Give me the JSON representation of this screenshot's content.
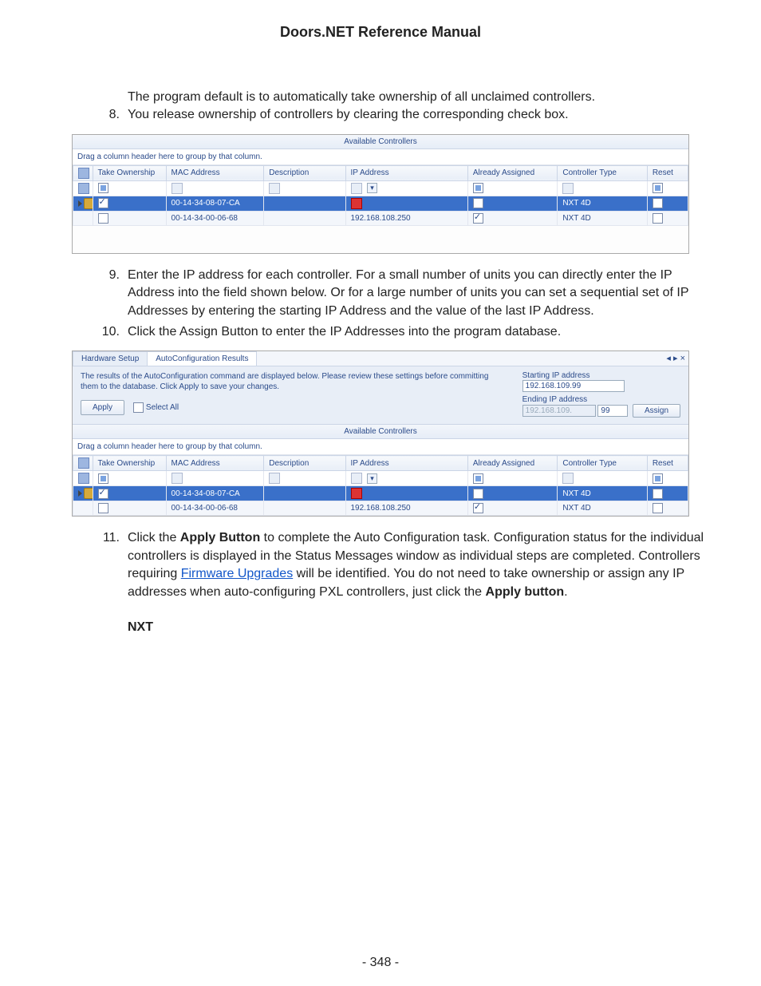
{
  "doc": {
    "title": "Doors.NET Reference Manual",
    "page_number": "- 348 -",
    "intro_line": "The program default is to automatically take ownership of all unclaimed controllers.",
    "step8": "You release ownership of controllers by clearing the corresponding check box.",
    "step9": "Enter the IP address for each controller. For a small number of units you can directly enter the IP Address into the field shown below. Or for a large number of units you can set a sequential set of IP Addresses by entering the starting IP Address and the value of the last IP Address.",
    "step10": "Click the Assign Button to enter the IP Addresses into the program database.",
    "step11_a": "Click the ",
    "step11_b": "Apply Button",
    "step11_c": " to complete the Auto Configuration task. Configuration status for the individual controllers is displayed in the Status Messages window as individual steps are completed. Controllers requiring ",
    "step11_link": "Firmware Upgrades",
    "step11_d": " will be identified. You do not need to take ownership or assign any IP addresses when auto-configuring PXL controllers, just click the ",
    "step11_e": "Apply button",
    "step11_f": ".",
    "section_nxt": "NXT"
  },
  "grid1": {
    "title": "Available Controllers",
    "hint": "Drag a column header here to group by that column.",
    "headers": {
      "take": "Take Ownership",
      "mac": "MAC Address",
      "desc": "Description",
      "ip": "IP Address",
      "assigned": "Already Assigned",
      "type": "Controller Type",
      "reset": "Reset"
    },
    "rows": [
      {
        "take": "sq",
        "mac": "",
        "desc": "",
        "ip": "",
        "assigned": "sq",
        "type": "",
        "reset": "sq",
        "filter": true
      },
      {
        "sel": true,
        "take": "checked",
        "mac": "00-14-34-08-07-CA",
        "desc": "",
        "ip": "!",
        "assigned": "",
        "type": "NXT 4D",
        "reset": ""
      },
      {
        "stripe": true,
        "take": "",
        "mac": "00-14-34-00-06-68",
        "desc": "",
        "ip": "192.168.108.250",
        "assigned": "checked",
        "type": "NXT 4D",
        "reset": ""
      }
    ]
  },
  "shot2": {
    "tabs": {
      "t1": "Hardware Setup",
      "t2": "AutoConfiguration Results",
      "close": "×"
    },
    "instr": "The results of the AutoConfiguration command are displayed below.  Please review these settings before committing them to the database.   Click Apply to save your changes.",
    "apply": "Apply",
    "select_all": "Select All",
    "start_label": "Starting IP address",
    "start_value": "192.168.109.99",
    "end_label": "Ending IP address",
    "end_prefix": "192.168.109.",
    "end_last": "99",
    "assign": "Assign"
  },
  "grid2": {
    "title": "Available Controllers",
    "hint": "Drag a column header here to group by that column.",
    "headers": {
      "take": "Take Ownership",
      "mac": "MAC Address",
      "desc": "Description",
      "ip": "IP Address",
      "assigned": "Already Assigned",
      "type": "Controller Type",
      "reset": "Reset"
    },
    "rows": [
      {
        "take": "sq",
        "mac": "",
        "desc": "",
        "ip": "",
        "assigned": "sq",
        "type": "",
        "reset": "sq",
        "filter": true
      },
      {
        "sel": true,
        "take": "checked",
        "mac": "00-14-34-08-07-CA",
        "desc": "",
        "ip": "!",
        "assigned": "",
        "type": "NXT 4D",
        "reset": ""
      },
      {
        "stripe": true,
        "take": "",
        "mac": "00-14-34-00-06-68",
        "desc": "",
        "ip": "192.168.108.250",
        "assigned": "checked",
        "type": "NXT 4D",
        "reset": ""
      }
    ]
  }
}
